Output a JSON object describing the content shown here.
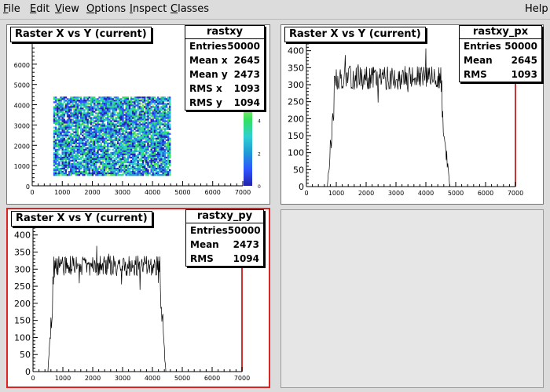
{
  "menus": [
    {
      "label": "File",
      "ul": "F"
    },
    {
      "label": "Edit",
      "ul": "E"
    },
    {
      "label": "View",
      "ul": "V"
    },
    {
      "label": "Options",
      "ul": "O"
    },
    {
      "label": "Inspect",
      "ul": "I"
    },
    {
      "label": "Classes",
      "ul": "C"
    }
  ],
  "help_label": "Help",
  "colors": {
    "accent": "#dd2222",
    "pad_bg": "#ffffff",
    "frame": "#000000",
    "plot_line": "#000000"
  },
  "pads": [
    {
      "title": "Raster X vs Y (current)",
      "active": false,
      "stats": {
        "name": "rastxy",
        "rows": [
          [
            "Entries",
            "50000"
          ],
          [
            "Mean x",
            "2645"
          ],
          [
            "Mean y",
            "2473"
          ],
          [
            "RMS x",
            "1093"
          ],
          [
            "RMS y",
            "1094"
          ]
        ]
      },
      "chart_data": {
        "type": "heatmap",
        "title": "Raster X vs Y (current)",
        "xlim": [
          0,
          7000
        ],
        "ylim": [
          0,
          7000
        ],
        "x_ticks": [
          "0",
          "1000",
          "2000",
          "3000",
          "4000",
          "5000",
          "6000",
          "7000"
        ],
        "y_ticks": [
          "0",
          "1000",
          "2000",
          "3000",
          "4000",
          "5000",
          "6000"
        ],
        "z_ticks": [
          "0",
          "2",
          "4",
          "6"
        ],
        "filled_region": {
          "x": [
            700,
            4600
          ],
          "y": [
            500,
            4400
          ]
        },
        "palette": [
          "#2222aa",
          "#2f54ff",
          "#1f9ad6",
          "#30d0d0",
          "#34e060",
          "#aef06a"
        ]
      }
    },
    {
      "title": "Raster X vs Y (current)",
      "active": false,
      "stats": {
        "name": "rastxy_px",
        "rows": [
          [
            "Entries",
            "50000"
          ],
          [
            "Mean",
            "2645"
          ],
          [
            "RMS",
            "1093"
          ]
        ]
      },
      "chart_data": {
        "type": "line",
        "title": "Raster X vs Y (current)",
        "xlim": [
          0,
          7000
        ],
        "ylim": [
          0,
          420
        ],
        "x_ticks": [
          "0",
          "1000",
          "2000",
          "3000",
          "4000",
          "5000",
          "6000",
          "7000"
        ],
        "y_ticks": [
          "0",
          "50",
          "100",
          "150",
          "200",
          "250",
          "300",
          "350",
          "400"
        ],
        "plateau": {
          "x_start": 750,
          "x_end": 4550,
          "level": 320,
          "noise": 35
        },
        "edges": {
          "rise": [
            700,
            950
          ],
          "fall": [
            4500,
            4800
          ]
        }
      }
    },
    {
      "title": "Raster X vs Y (current)",
      "active": true,
      "stats": {
        "name": "rastxy_py",
        "rows": [
          [
            "Entries",
            "50000"
          ],
          [
            "Mean",
            "2473"
          ],
          [
            "RMS",
            "1094"
          ]
        ]
      },
      "chart_data": {
        "type": "line",
        "title": "Raster X vs Y (current)",
        "xlim": [
          0,
          7000
        ],
        "ylim": [
          0,
          420
        ],
        "x_ticks": [
          "0",
          "1000",
          "2000",
          "3000",
          "4000",
          "5000",
          "6000",
          "7000"
        ],
        "y_ticks": [
          "0",
          "50",
          "100",
          "150",
          "200",
          "250",
          "300",
          "350",
          "400"
        ],
        "plateau": {
          "x_start": 650,
          "x_end": 4300,
          "level": 310,
          "noise": 30
        },
        "edges": {
          "rise": [
            500,
            700
          ],
          "fall": [
            4250,
            4450
          ]
        }
      }
    },
    {
      "empty": true
    }
  ]
}
